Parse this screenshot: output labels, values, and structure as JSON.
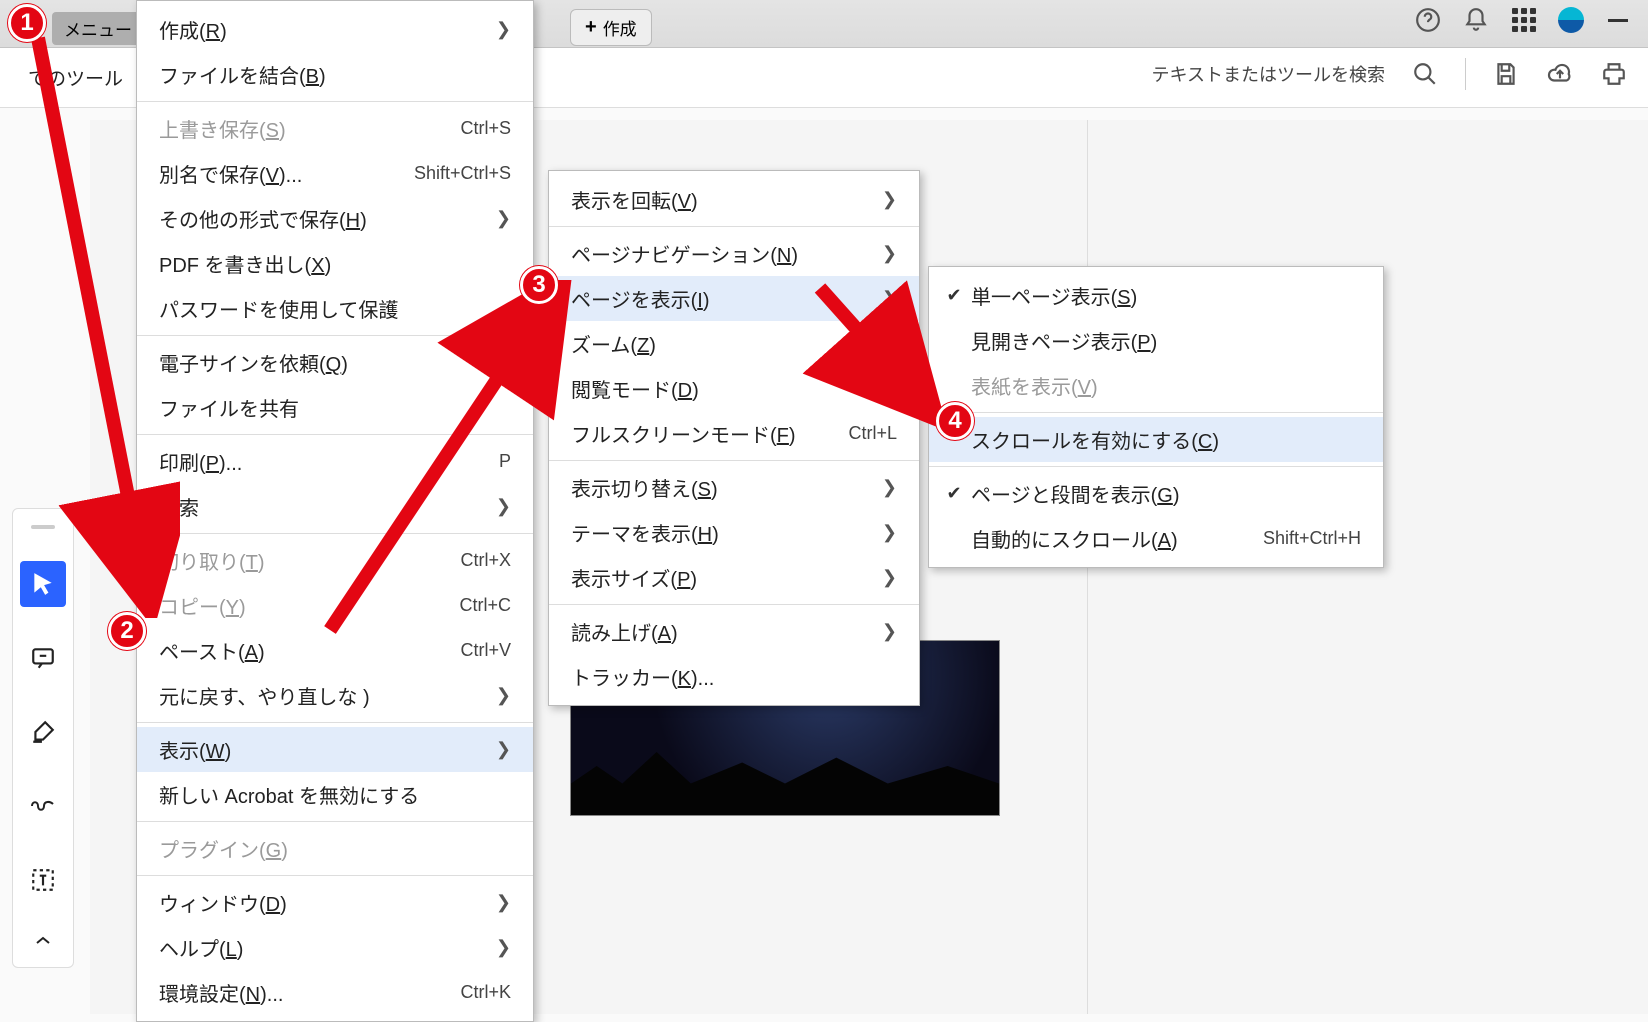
{
  "toolbar": {
    "menu_button": "メニュー",
    "create_button": "作成",
    "all_tools": "てのツール",
    "search_placeholder": "テキストまたはツールを検索"
  },
  "main_menu": {
    "items": [
      {
        "label": "作成(R)",
        "shortcut": "",
        "arrow": true,
        "disabled": false,
        "partial": true
      },
      {
        "label": "ファイルを結合(B)",
        "shortcut": ""
      },
      {
        "sep": true
      },
      {
        "label": "上書き保存(S)",
        "shortcut": "Ctrl+S",
        "disabled": true
      },
      {
        "label": "別名で保存(V)...",
        "shortcut": "Shift+Ctrl+S"
      },
      {
        "label": "その他の形式で保存(H)",
        "arrow": true
      },
      {
        "label": "PDF を書き出し(X)"
      },
      {
        "label": "パスワードを使用して保護"
      },
      {
        "sep": true
      },
      {
        "label": "電子サインを依頼(Q)"
      },
      {
        "label": "ファイルを共有"
      },
      {
        "sep": true
      },
      {
        "label": "印刷(P)...",
        "shortcut": "     P",
        "shortcut_partial": true
      },
      {
        "label": "検索",
        "arrow": true
      },
      {
        "sep": true
      },
      {
        "label": "切り取り(T)",
        "shortcut": "Ctrl+X",
        "disabled": true
      },
      {
        "label": "コピー(Y)",
        "shortcut": "Ctrl+C",
        "disabled": true
      },
      {
        "label": "ペースト(A)",
        "shortcut": "Ctrl+V"
      },
      {
        "label": "元に戻す、やり直しな    )",
        "shortcut": "",
        "arrow": true
      },
      {
        "sep": true
      },
      {
        "label": "表示(W)",
        "arrow": true,
        "highlight": true
      },
      {
        "label": "新しい Acrobat を無効にする"
      },
      {
        "sep": true
      },
      {
        "label": "プラグイン(G)",
        "disabled": true
      },
      {
        "sep": true
      },
      {
        "label": "ウィンドウ(D)",
        "arrow": true
      },
      {
        "label": "ヘルプ(L)",
        "arrow": true
      },
      {
        "label": "環境設定(N)...",
        "shortcut": "Ctrl+K"
      }
    ]
  },
  "view_submenu": {
    "items": [
      {
        "label": "表示を回転(V)",
        "arrow": true
      },
      {
        "sep": true
      },
      {
        "label": "ページナビゲーション(N)",
        "arrow": true
      },
      {
        "label": "ページを表示(I)",
        "arrow": true,
        "highlight": true
      },
      {
        "label": "ズーム(Z)",
        "arrow": true
      },
      {
        "label": "閲覧モード(D)",
        "shortcut": "Ctr"
      },
      {
        "label": "フルスクリーンモード(F)",
        "shortcut": "Ctrl+L"
      },
      {
        "sep": true
      },
      {
        "label": "表示切り替え(S)",
        "arrow": true
      },
      {
        "label": "テーマを表示(H)",
        "arrow": true
      },
      {
        "label": "表示サイズ(P)",
        "arrow": true
      },
      {
        "sep": true
      },
      {
        "label": "読み上げ(A)",
        "arrow": true
      },
      {
        "label": "トラッカー(K)..."
      }
    ]
  },
  "page_display_submenu": {
    "items": [
      {
        "label": "単一ページ表示(S)",
        "check": true
      },
      {
        "label": "見開きページ表示(P)"
      },
      {
        "label": "表紙を表示(V)",
        "disabled": true
      },
      {
        "sep": true
      },
      {
        "label": "スクロールを有効にする(C)",
        "highlight": true
      },
      {
        "sep": true
      },
      {
        "label": "ページと段間を表示(G)",
        "check": true
      },
      {
        "label": "自動的にスクロール(A)",
        "shortcut": "Shift+Ctrl+H"
      }
    ]
  },
  "annotations": {
    "b1": "1",
    "b2": "2",
    "b3": "3",
    "b4": "4"
  }
}
